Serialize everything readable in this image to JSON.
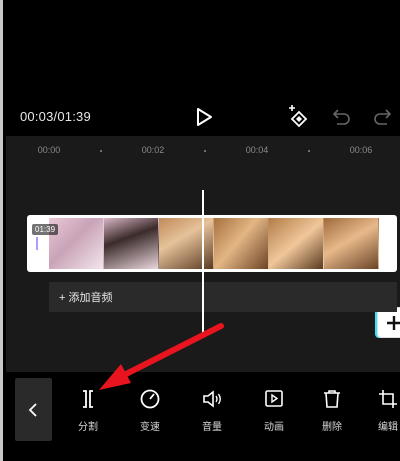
{
  "player": {
    "time_display": "00:03/01:39",
    "play_icon": "play-icon",
    "keyframe_icon": "keyframe-add-icon",
    "undo_icon": "undo-icon",
    "redo_icon": "redo-icon"
  },
  "ruler": {
    "ticks": [
      "00:00",
      "00:02",
      "00:04",
      "00:06"
    ]
  },
  "clip": {
    "duration": "01:39",
    "add_icon": "plus-icon"
  },
  "audio": {
    "add_label": "+ 添加音频"
  },
  "toolbar": {
    "back_icon": "chevron-left-icon",
    "tools": [
      {
        "label": "分割",
        "icon": "split-icon"
      },
      {
        "label": "变速",
        "icon": "speed-icon"
      },
      {
        "label": "音量",
        "icon": "volume-icon"
      },
      {
        "label": "动画",
        "icon": "animation-icon"
      },
      {
        "label": "删除",
        "icon": "delete-icon"
      },
      {
        "label": "编辑",
        "icon": "crop-icon"
      }
    ]
  },
  "colors": {
    "background": "#000000",
    "timeline_bg": "#1a1a1a",
    "annotation_arrow": "#e8141e"
  }
}
